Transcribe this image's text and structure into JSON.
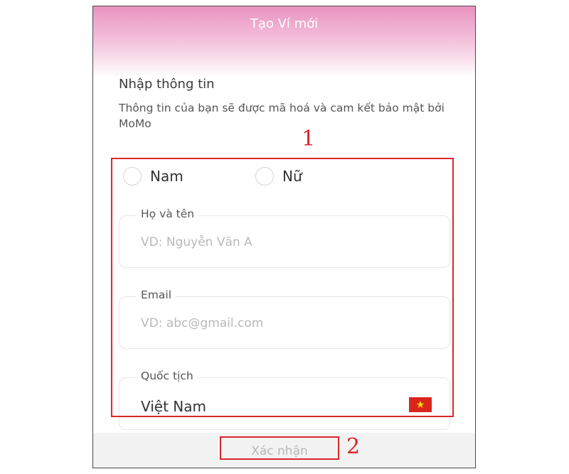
{
  "header": {
    "title": "Tạo Ví mới"
  },
  "intro": {
    "title": "Nhập thông tin",
    "description": "Thông tin của bạn sẽ được mã hoá và cam kết bảo mật bởi MoMo"
  },
  "form": {
    "gender_options": [
      "Nam",
      "Nữ"
    ],
    "full_name": {
      "label": "Họ và tên",
      "placeholder": "VD: Nguyễn Văn A",
      "value": ""
    },
    "email": {
      "label": "Email",
      "placeholder": "VD: abc@gmail.com",
      "value": ""
    },
    "nationality": {
      "label": "Quốc tịch",
      "value": "Việt Nam",
      "flag_icon": "vietnam-flag-icon"
    }
  },
  "actions": {
    "confirm_label": "Xác nhận"
  },
  "annotations": {
    "form_marker": "1",
    "button_marker": "2",
    "color": "#d9262c"
  },
  "colors": {
    "header_gradient_top": "#e993c0",
    "accent_annotation": "#d9262c"
  }
}
